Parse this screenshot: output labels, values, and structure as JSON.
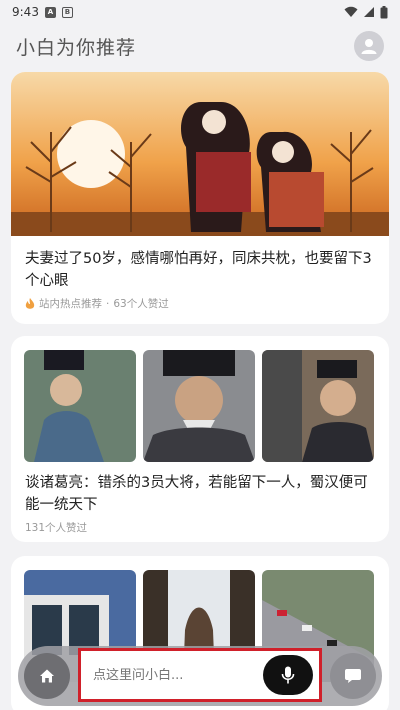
{
  "status_bar": {
    "time": "9:43",
    "notif_a": "A",
    "notif_b": "B"
  },
  "header": {
    "title": "小白为你推荐"
  },
  "feed": [
    {
      "title": "夫妻过了50岁，感情哪怕再好，同床共枕，也要留下3个心眼",
      "source": "站内热点推荐",
      "separator": "·",
      "likes": "63个人赞过"
    },
    {
      "title": "谈诸葛亮：错杀的3员大将，若能留下一人，蜀汉便可能一统天下",
      "likes": "131个人赞过"
    },
    {
      "title": ""
    }
  ],
  "bottom_bar": {
    "ask_placeholder": "点这里问小白..."
  },
  "colors": {
    "highlight": "#d0202a",
    "background": "#f2f2f4"
  }
}
